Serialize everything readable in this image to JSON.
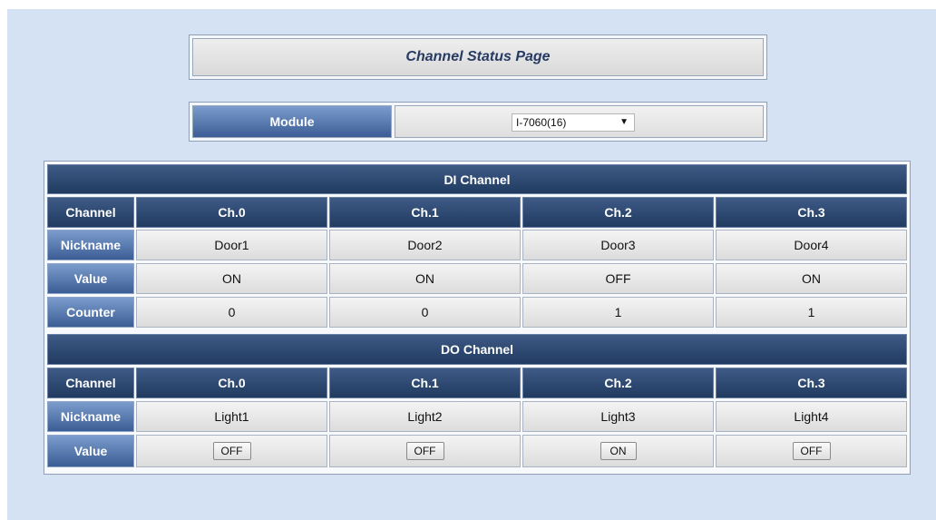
{
  "title": "Channel Status Page",
  "module": {
    "label": "Module",
    "selected": "I-7060(16)"
  },
  "di": {
    "heading": "DI Channel",
    "channel_label": "Channel",
    "nickname_label": "Nickname",
    "value_label": "Value",
    "counter_label": "Counter",
    "channels": [
      "Ch.0",
      "Ch.1",
      "Ch.2",
      "Ch.3"
    ],
    "nicknames": [
      "Door1",
      "Door2",
      "Door3",
      "Door4"
    ],
    "values": [
      "ON",
      "ON",
      "OFF",
      "ON"
    ],
    "counters": [
      "0",
      "0",
      "1",
      "1"
    ]
  },
  "do": {
    "heading": "DO Channel",
    "channel_label": "Channel",
    "nickname_label": "Nickname",
    "value_label": "Value",
    "channels": [
      "Ch.0",
      "Ch.1",
      "Ch.2",
      "Ch.3"
    ],
    "nicknames": [
      "Light1",
      "Light2",
      "Light3",
      "Light4"
    ],
    "values": [
      "OFF",
      "OFF",
      "ON",
      "OFF"
    ]
  }
}
